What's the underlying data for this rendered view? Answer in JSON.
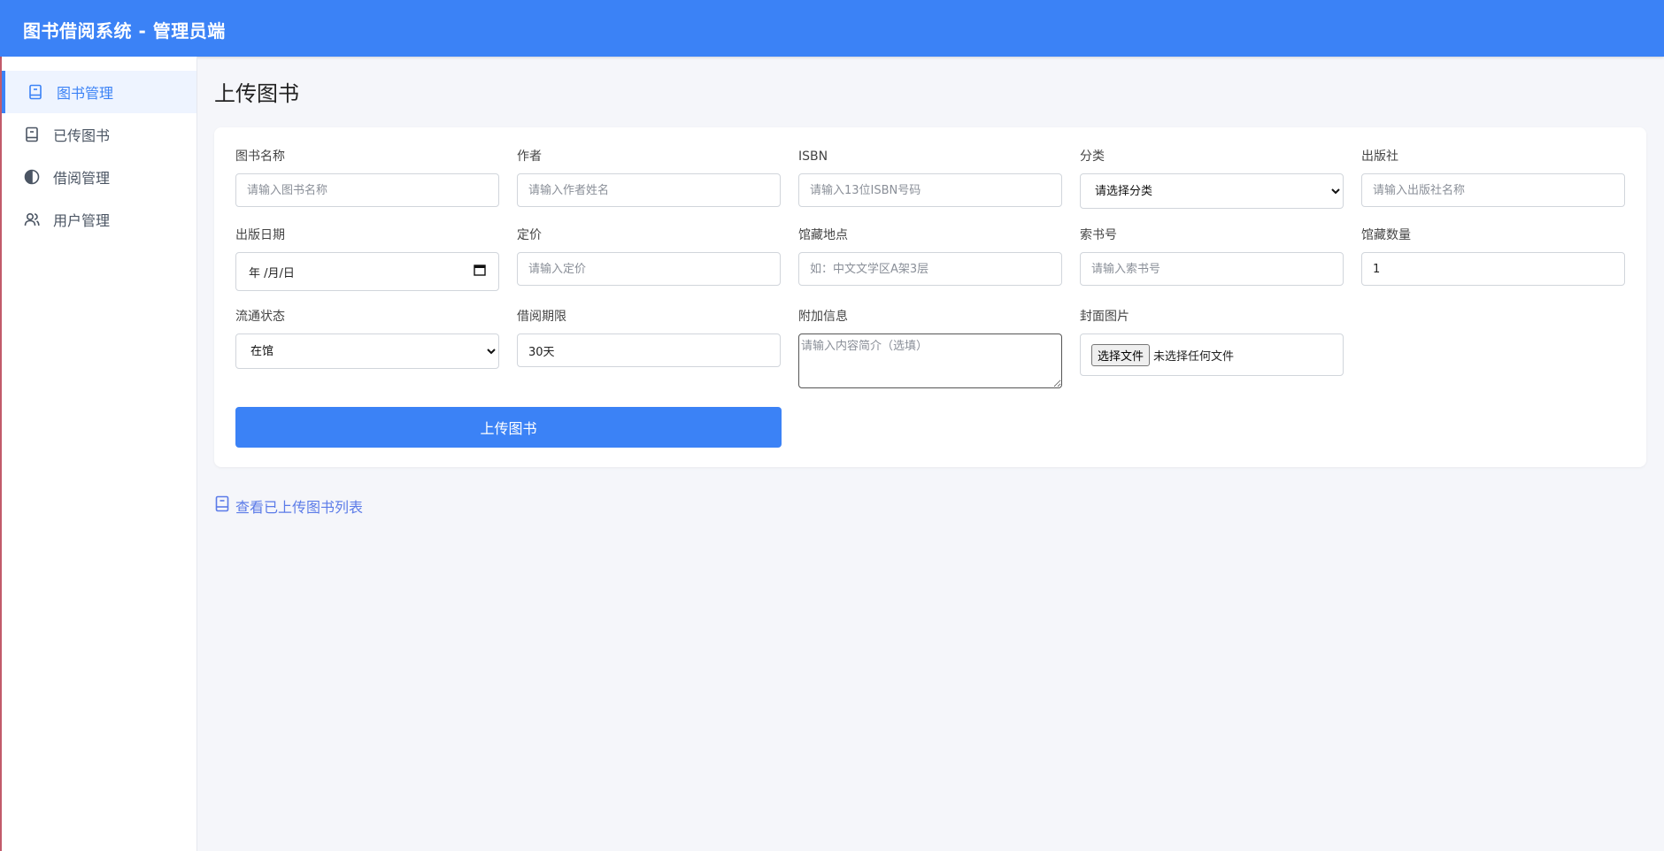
{
  "header": {
    "title": "图书借阅系统 - 管理员端"
  },
  "sidebar": {
    "items": [
      {
        "label": "图书管理",
        "icon": "book-icon",
        "active": true
      },
      {
        "label": "已传图书",
        "icon": "book-icon",
        "active": false
      },
      {
        "label": "借阅管理",
        "icon": "half-circle-icon",
        "active": false
      },
      {
        "label": "用户管理",
        "icon": "users-icon",
        "active": false
      }
    ]
  },
  "main": {
    "title": "上传图书",
    "form": {
      "book_name": {
        "label": "图书名称",
        "placeholder": "请输入图书名称"
      },
      "author": {
        "label": "作者",
        "placeholder": "请输入作者姓名"
      },
      "isbn": {
        "label": "ISBN",
        "placeholder": "请输入13位ISBN号码"
      },
      "category": {
        "label": "分类",
        "selected": "请选择分类"
      },
      "publisher": {
        "label": "出版社",
        "placeholder": "请输入出版社名称"
      },
      "publish_date": {
        "label": "出版日期",
        "value": "年 /月/日"
      },
      "price": {
        "label": "定价",
        "placeholder": "请输入定价"
      },
      "location": {
        "label": "馆藏地点",
        "placeholder": "如：中文文学区A架3层"
      },
      "call_number": {
        "label": "索书号",
        "placeholder": "请输入索书号"
      },
      "quantity": {
        "label": "馆藏数量",
        "value": "1"
      },
      "status": {
        "label": "流通状态",
        "selected": "在馆"
      },
      "loan_period": {
        "label": "借阅期限",
        "value": "30天"
      },
      "extra_info": {
        "label": "附加信息",
        "placeholder": "请输入内容简介（选填）"
      },
      "cover": {
        "label": "封面图片",
        "button": "选择文件",
        "status": "未选择任何文件"
      },
      "submit_label": "上传图书"
    },
    "list_link": "查看已上传图书列表"
  }
}
